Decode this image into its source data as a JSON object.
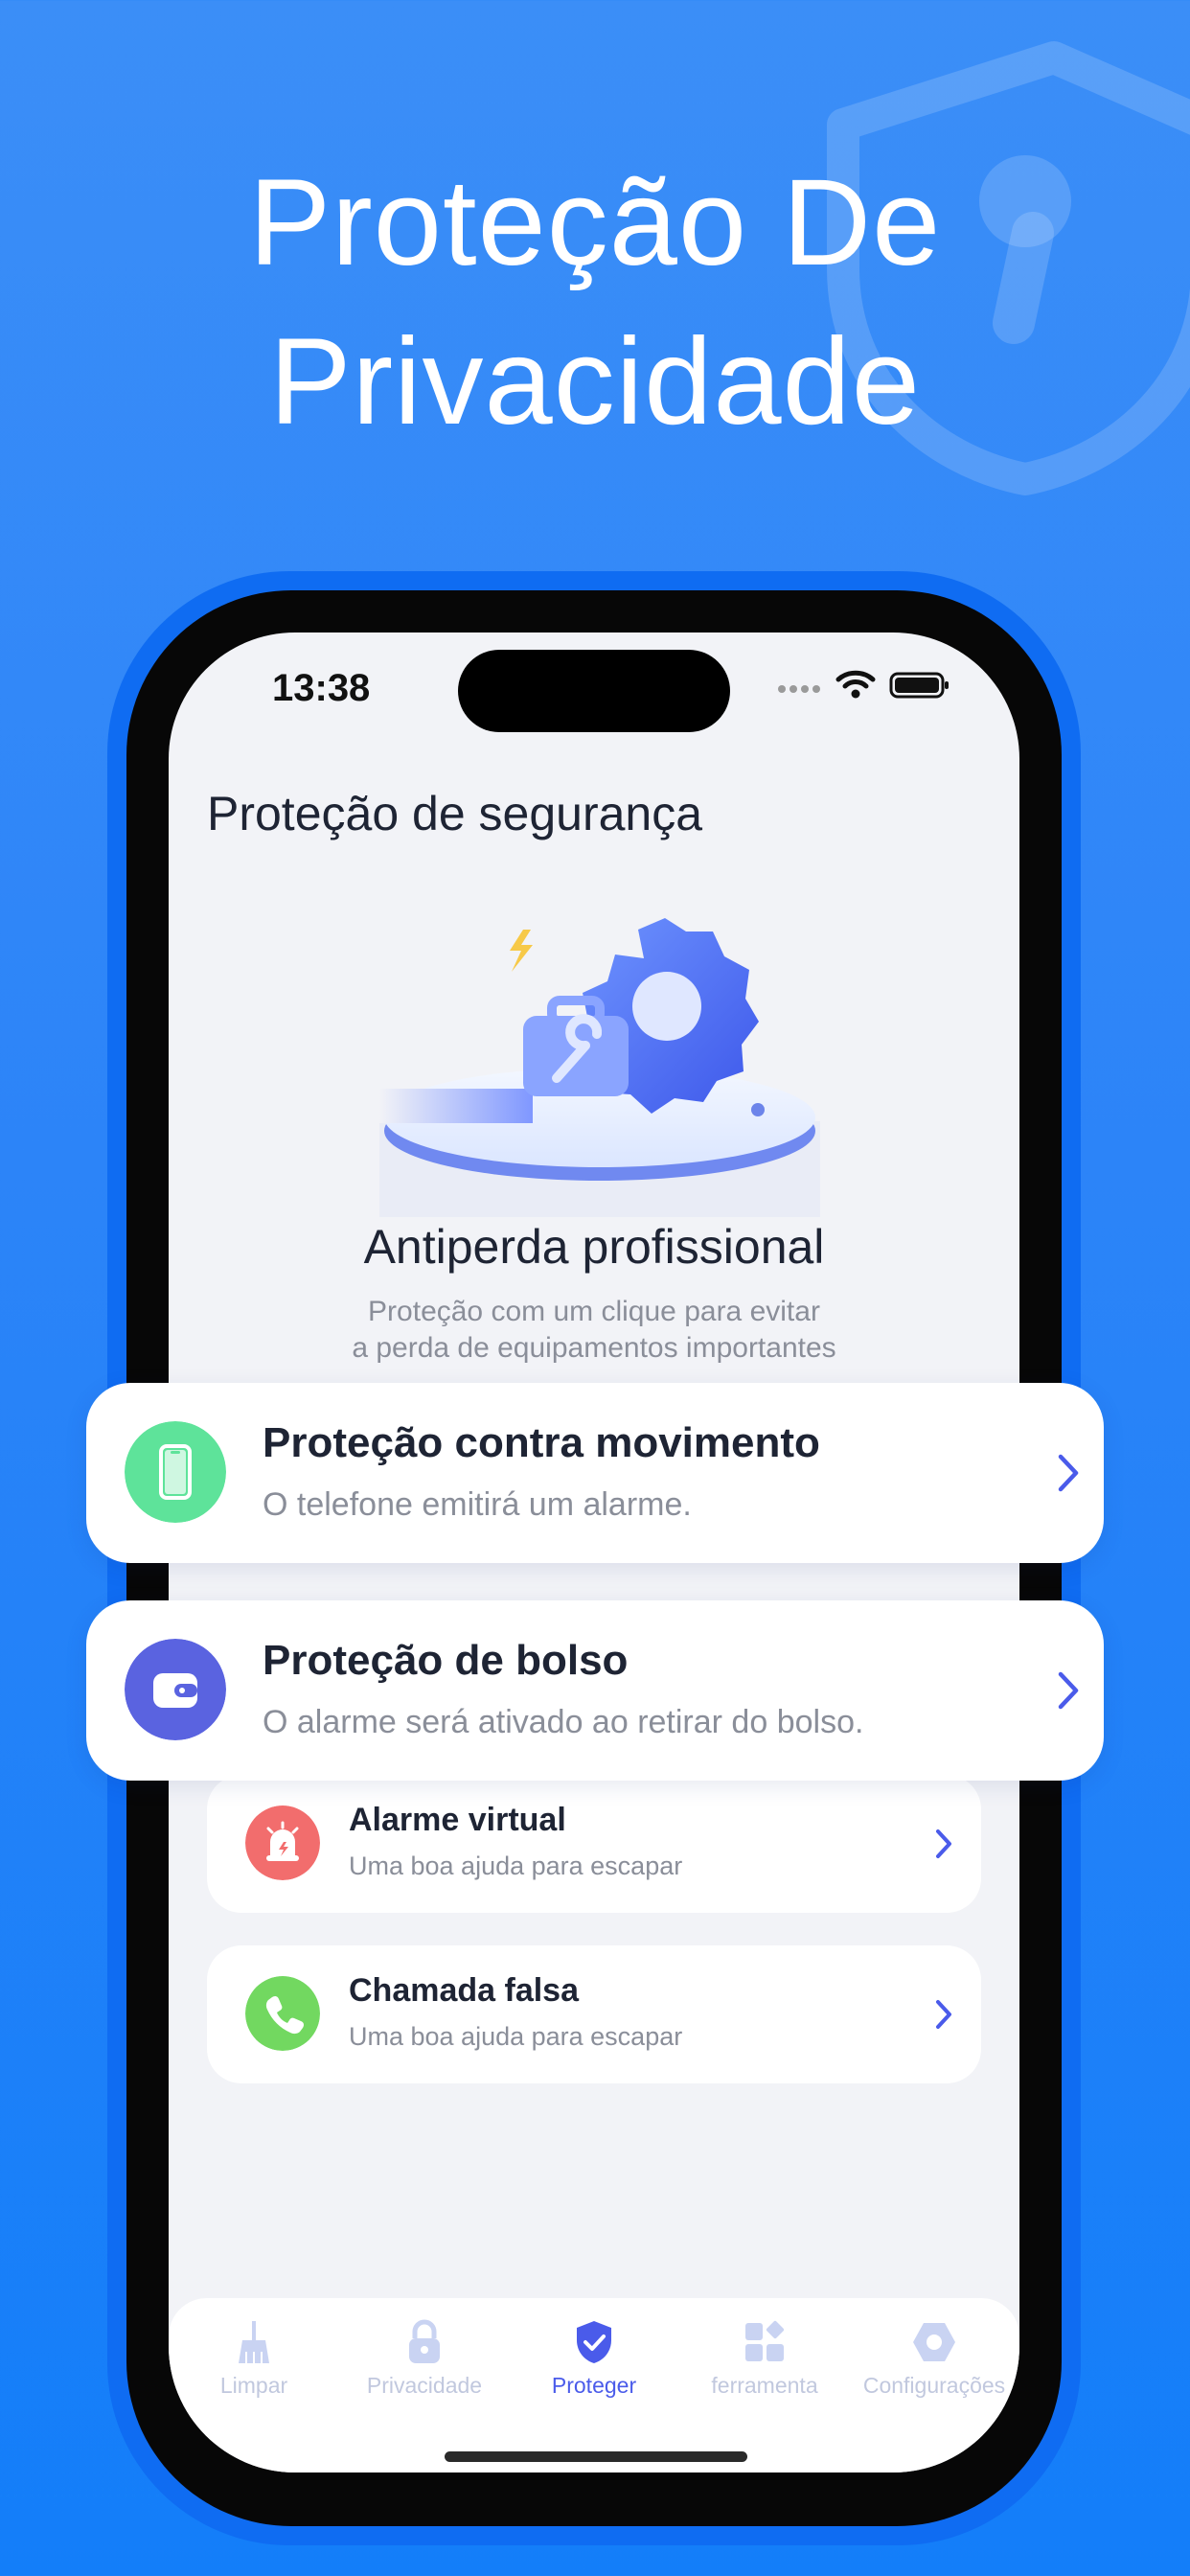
{
  "hero": {
    "line1": "Proteção De",
    "line2": "Privacidade"
  },
  "status_bar": {
    "time": "13:38"
  },
  "screen": {
    "title": "Proteção de segurança",
    "section_title": "Antiperda profissional",
    "section_desc_line1": "Proteção com um clique para evitar",
    "section_desc_line2": "a perda de equipamentos importantes"
  },
  "feature_cards": [
    {
      "title": "Proteção contra movimento",
      "subtitle": "O telefone emitirá um alarme.",
      "icon": "phone-icon",
      "color": "#5ee39a"
    },
    {
      "title": "Proteção de bolso",
      "subtitle": "O alarme será ativado ao retirar do bolso.",
      "icon": "wallet-icon",
      "color": "#5a63e0"
    }
  ],
  "list_items": [
    {
      "title": "Alarme virtual",
      "subtitle": "Uma boa ajuda para escapar",
      "icon": "siren-icon",
      "color": "#f26d6d"
    },
    {
      "title": "Chamada falsa",
      "subtitle": "Uma boa ajuda para escapar",
      "icon": "phone-call-icon",
      "color": "#72d860"
    }
  ],
  "tabs": [
    {
      "label": "Limpar",
      "icon": "broom-icon",
      "active": false
    },
    {
      "label": "Privacidade",
      "icon": "lock-icon",
      "active": false
    },
    {
      "label": "Proteger",
      "icon": "shield-check-icon",
      "active": true
    },
    {
      "label": "ferramenta",
      "icon": "tools-grid-icon",
      "active": false
    },
    {
      "label": "Configurações",
      "icon": "settings-hexagon-icon",
      "active": false
    }
  ],
  "colors": {
    "background": "#2c84f8",
    "accent": "#4a5bea",
    "tab_inactive": "#c1c8de"
  }
}
